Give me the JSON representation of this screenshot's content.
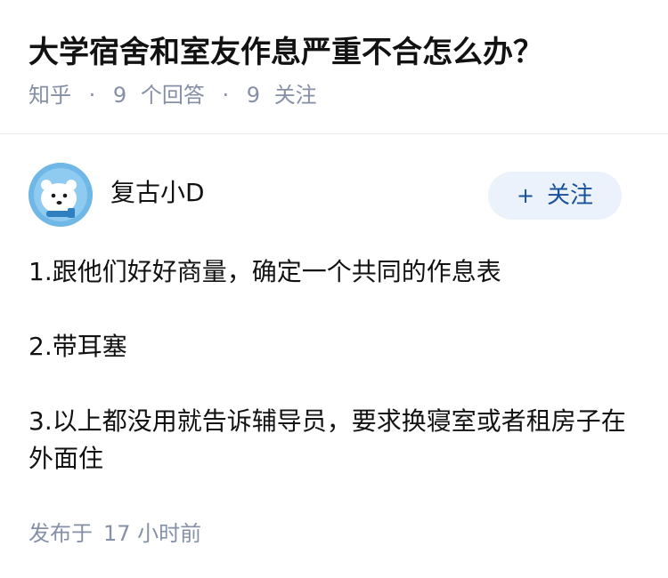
{
  "question": {
    "title": "大学宿舍和室友作息严重不合怎么办？",
    "source": "知乎",
    "answers_count": "9",
    "answers_label": "个回答",
    "followers_count": "9",
    "followers_label": "关注"
  },
  "answer": {
    "author_name": "复古小D",
    "follow_label": "关注",
    "paragraphs": [
      "1.跟他们好好商量，确定一个共同的作息表",
      "2.带耳塞",
      "3.以上都没用就告诉辅导员，要求换寝室或者租房子在外面住"
    ],
    "publish_prefix": "发布于",
    "publish_time": "17 小时前"
  },
  "colors": {
    "title_text": "#121212",
    "meta_text": "#8590a6",
    "follow_bg": "#ebf2fb",
    "follow_text": "#175199",
    "avatar_bg": "#6fb7e6"
  },
  "icons": {
    "avatar": "polar-bear-avatar-icon",
    "follow": "plus-icon"
  }
}
